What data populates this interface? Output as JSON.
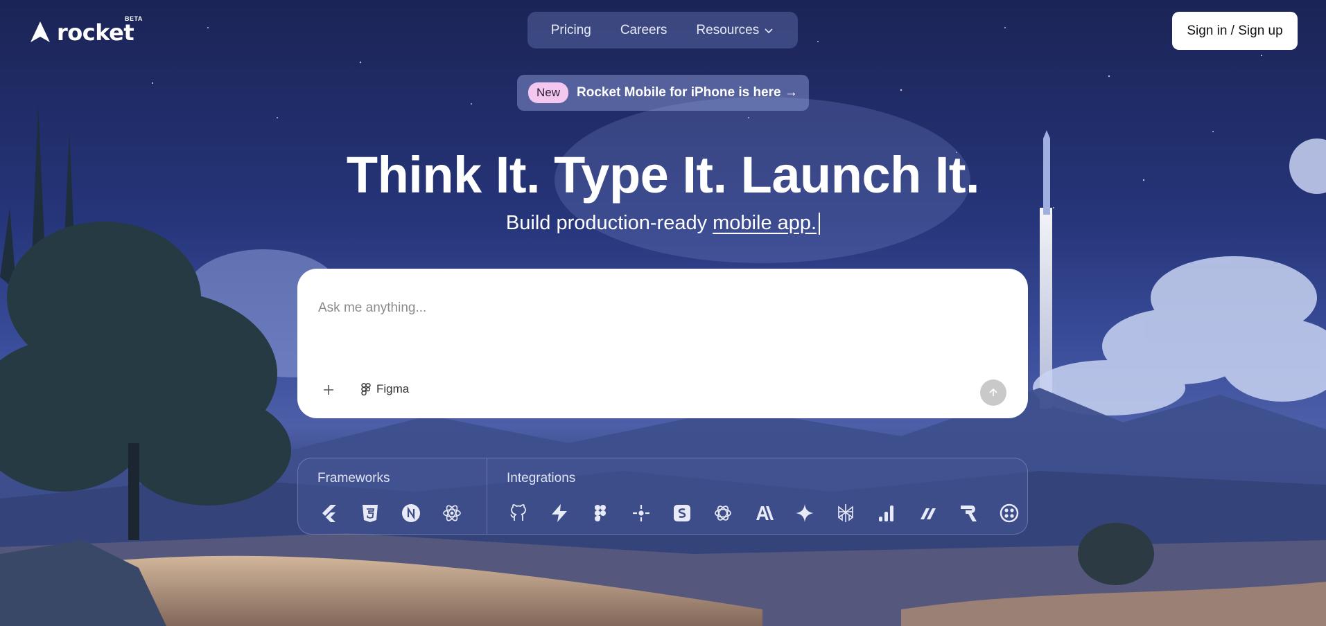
{
  "brand": {
    "name": "rocket",
    "badge": "BETA"
  },
  "nav": {
    "items": [
      {
        "label": "Pricing"
      },
      {
        "label": "Careers"
      },
      {
        "label": "Resources"
      }
    ]
  },
  "auth": {
    "signin_label": "Sign in / Sign up"
  },
  "announcement": {
    "badge": "New",
    "text": "Rocket Mobile for iPhone is here →"
  },
  "hero": {
    "headline": "Think It. Type It. Launch It.",
    "sub_prefix": "Build production-ready",
    "sub_accent": "mobile app."
  },
  "prompt": {
    "placeholder": "Ask me anything...",
    "value": "",
    "figma_label": "Figma"
  },
  "frameworks": {
    "label": "Frameworks",
    "icons": [
      "flutter-icon",
      "html5-icon",
      "nextjs-icon",
      "react-icon"
    ]
  },
  "integrations": {
    "label": "Integrations",
    "icons": [
      "github-icon",
      "supabase-icon",
      "figma-icon",
      "openrouter-icon",
      "stripe-icon",
      "openai-icon",
      "anthropic-icon",
      "gemini-icon",
      "perplexity-icon",
      "analytics-icon",
      "resend-icon",
      "rapidapi-icon",
      "twilio-icon"
    ]
  },
  "colors": {
    "accent_badge": "#f3c7ef",
    "button_bg": "#ffffff",
    "send_button": "#c9c9c9"
  }
}
